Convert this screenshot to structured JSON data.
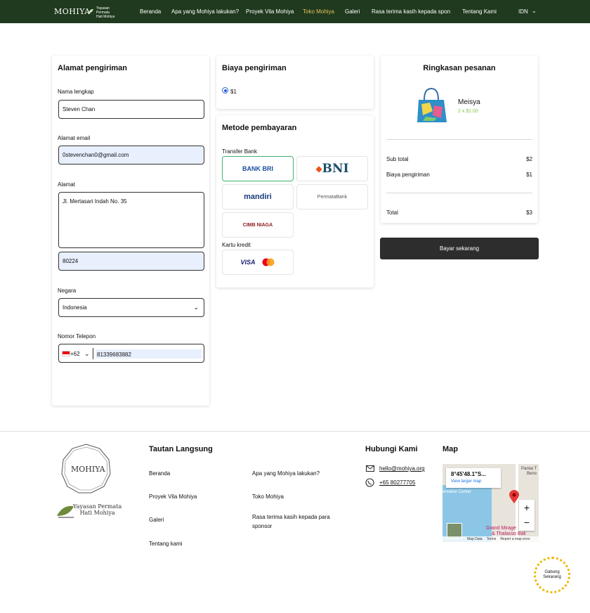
{
  "nav": {
    "logo": "MOHIYA",
    "org_line1": "Yayasan Permata",
    "org_line2": "Hati Mohiya",
    "items": [
      "Beranda",
      "Apa yang Mohiya lakukan?",
      "Proyek Vila Mohiya",
      "Toko Mohiya",
      "Galeri",
      "Rasa terima kasih kepada sponsor",
      "Tentang Kami"
    ],
    "lang": "IDN"
  },
  "address": {
    "title": "Alamat pengiriman",
    "name_label": "Nama lengkap",
    "name_value": "Steven Chan",
    "email_label": "Alamat email",
    "email_value": "0stevenchan0@gmail.com",
    "address_label": "Alamat",
    "address_value": "Jl. Mertasari Indah No. 35",
    "postal_value": "80224",
    "country_label": "Negara",
    "country_value": "Indonesia",
    "phone_label": "Nomor Telepon",
    "phone_code": "+62",
    "phone_value": "81339683882"
  },
  "shipping": {
    "title": "Biaya pengiriman",
    "option": "$1"
  },
  "payment": {
    "title": "Metode pembayaran",
    "transfer_label": "Transfer Bank",
    "banks": [
      "BANK BRI",
      "BNI",
      "mandiri",
      "PermataBank",
      "CIMB NIAGA"
    ],
    "card_label": "Kartu kredit",
    "card_brand": "VISA"
  },
  "summary": {
    "title": "Ringkasan pesanan",
    "product": "Meisya",
    "qty": "2 x $1.00",
    "subtotal_label": "Sub total",
    "subtotal": "$2",
    "shipping_label": "Biaya pengiriman",
    "shipping": "$1",
    "total_label": "Total",
    "total": "$3",
    "pay_button": "Bayar sekarang"
  },
  "footer": {
    "logo": "MOHIYA",
    "org_line1": "Yayasan Permata",
    "org_line2": "Hati Mohiya",
    "links_title": "Tautan Langsung",
    "links": [
      "Beranda",
      "Proyek Vila Mohiya",
      "Galeri",
      "Tentang kami",
      "Apa yang Mohiya lakukan?",
      "Toko Mohiya",
      "Rasa terima kasih kepada para sponsor"
    ],
    "contact_title": "Hubungi Kami",
    "email": "hello@mohiya.org",
    "phone": "+65 80277705",
    "map_title": "Map",
    "map_coords": "8°45'48.1\"S...",
    "map_link": "View larger map",
    "map_place1": "Pantai T",
    "map_place2": "Beno",
    "map_place3": "ervation Center",
    "map_place4": "Grand Mirage",
    "map_place5": "& Thalasso Bali",
    "map_footer1": "Map Data",
    "map_footer2": "Terms",
    "map_footer3": "Report a map error",
    "badge_line1": "Gabung",
    "badge_line2": "Sekarang"
  }
}
